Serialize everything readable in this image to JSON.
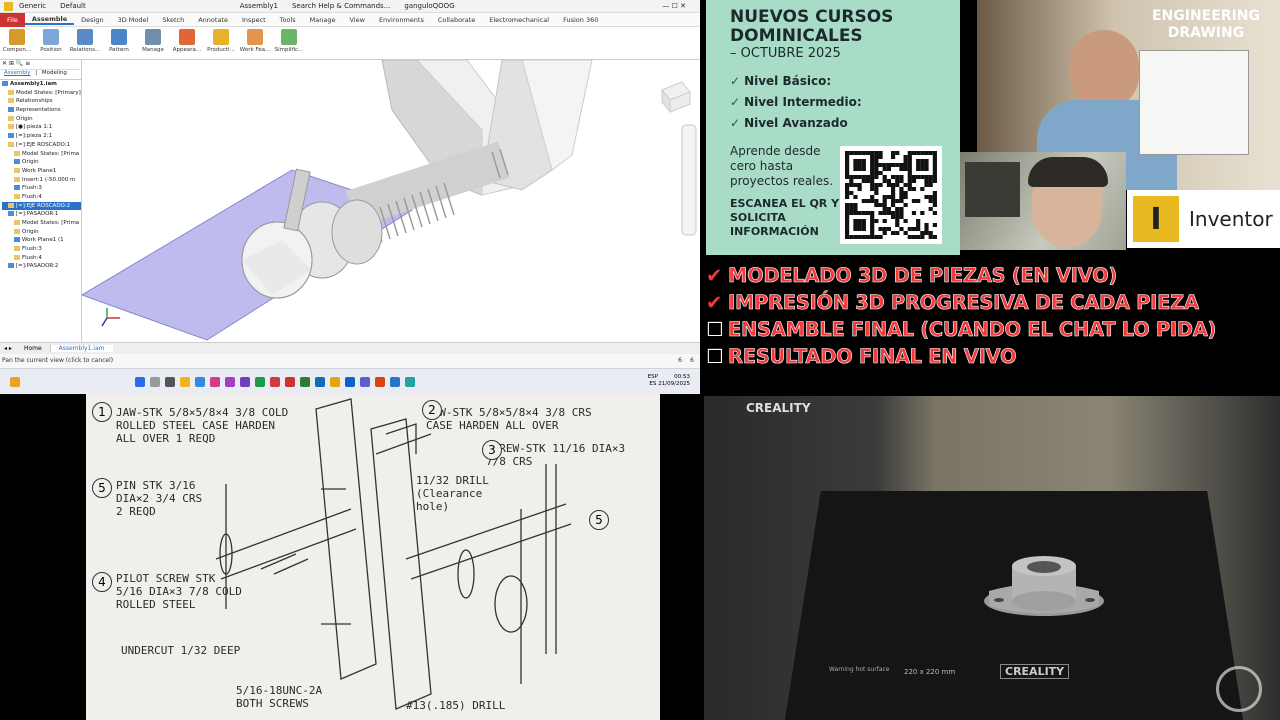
{
  "inventor": {
    "titlebar": {
      "preset": "Generic",
      "display": "Default",
      "doc": "Assembly1",
      "search": "Search Help & Commands...",
      "user": "ganguloQOOG"
    },
    "menu": [
      "File",
      "Assemble",
      "Design",
      "3D Model",
      "Sketch",
      "Annotate",
      "Inspect",
      "Tools",
      "Manage",
      "View",
      "Environments",
      "Collaborate",
      "Electromechanical",
      "Fusion 360"
    ],
    "ribbon": [
      {
        "label": "Compon...",
        "color": "#d49b2b"
      },
      {
        "label": "Position",
        "color": "#7aa7d8"
      },
      {
        "label": "Relations...",
        "color": "#5b8ac8"
      },
      {
        "label": "Pattern",
        "color": "#4b85c9"
      },
      {
        "label": "Manage",
        "color": "#6f8fb0"
      },
      {
        "label": "Appeara...",
        "color": "#e0663a"
      },
      {
        "label": "Producti...",
        "color": "#e7b12c"
      },
      {
        "label": "Work Fea...",
        "color": "#e2954b"
      },
      {
        "label": "Simplific...",
        "color": "#6bb46a"
      }
    ],
    "browser_tabs": {
      "assembly": "Assembly",
      "modeling": "Modeling"
    },
    "tree": [
      "Assembly1.iam",
      "Model States: [Primary]",
      "Relationships",
      "Representations",
      "Origin",
      "[●]:pieza 1:1",
      "[=]:pieza 2:1",
      "[=]:EJE ROSCADO:1",
      "Model States: [Prima",
      "Origin",
      "Work Plane1",
      "Insert:1 (-50.000 m",
      "Flush:3",
      "Flush:4",
      "[=]:EJE ROSCADO:2",
      "[=]:PASADOR:1",
      "Model States: [Prima",
      "Origin",
      "Work Plane1 (1",
      "Flush:3",
      "Flush:4",
      "[=]:PASADOR:2"
    ],
    "doc_tabs": {
      "home": "Home",
      "file": "Assembly1.iam"
    },
    "status": "Pan the current view (click to cancel)",
    "status_counts": [
      "6",
      "6"
    ],
    "clock": {
      "time": "00:53",
      "date": "21/09/2025",
      "lang": "ESP",
      "region": "ES"
    }
  },
  "promo": {
    "title": [
      "NUEVOS CURSOS",
      "DOMINICALES"
    ],
    "subtitle": "– OCTUBRE 2025",
    "levels": [
      "Nivel Básico:",
      "Nivel Intermedio:",
      "Nivel Avanzado"
    ],
    "pitch": "Aprende desde cero hasta proyectos reales.",
    "cta": "ESCANEA EL QR Y SOLICITA INFORMACIÓN"
  },
  "cam": {
    "board_title": [
      "ENGINEERING",
      "DRAWING"
    ]
  },
  "inventor_logo": {
    "letter": "I",
    "name": "Inventor",
    "color": "#e8b920"
  },
  "checklist": [
    {
      "mark": "✔",
      "done": true,
      "text": "MODELADO 3D DE PIEZAS (EN VIVO)"
    },
    {
      "mark": "✔",
      "done": true,
      "text": "IMPRESIÓN 3D PROGRESIVA DE CADA PIEZA"
    },
    {
      "mark": "☐",
      "done": false,
      "text": "ENSAMBLE FINAL (CUANDO EL CHAT LO PIDA)"
    },
    {
      "mark": "☐",
      "done": false,
      "text": "RESULTADO FINAL EN VIVO"
    }
  ],
  "drawing": {
    "callouts": [
      "JAW-STK 5/8×5/8×4 3/8 COLD ROLLED STEEL CASE HARDEN ALL OVER 1 REQD",
      "JAW-STK 5/8×5/8×4 3/8 CRS CASE HARDEN ALL OVER",
      "SCREW-STK 11/16 DIA×3 7/8 CRS",
      "PILOT SCREW STK 5/16 DIA×3 7/8 COLD ROLLED STEEL",
      "PIN STK 3/16 DIA×2 3/4 CRS 2 REQD",
      "UNDERCUT 1/32 DEEP",
      "5/16-18UNC-2A BOTH SCREWS",
      "11/32 DRILL (Clearance hole)",
      "#13(.185) DRILL"
    ],
    "numbers": [
      "1",
      "2",
      "3",
      "4",
      "5",
      "5"
    ]
  },
  "printer": {
    "brand": "CREALITY",
    "bed": "220 x 220 mm",
    "bed_brand": "CREALITY",
    "warning": "Warning hot surface"
  }
}
